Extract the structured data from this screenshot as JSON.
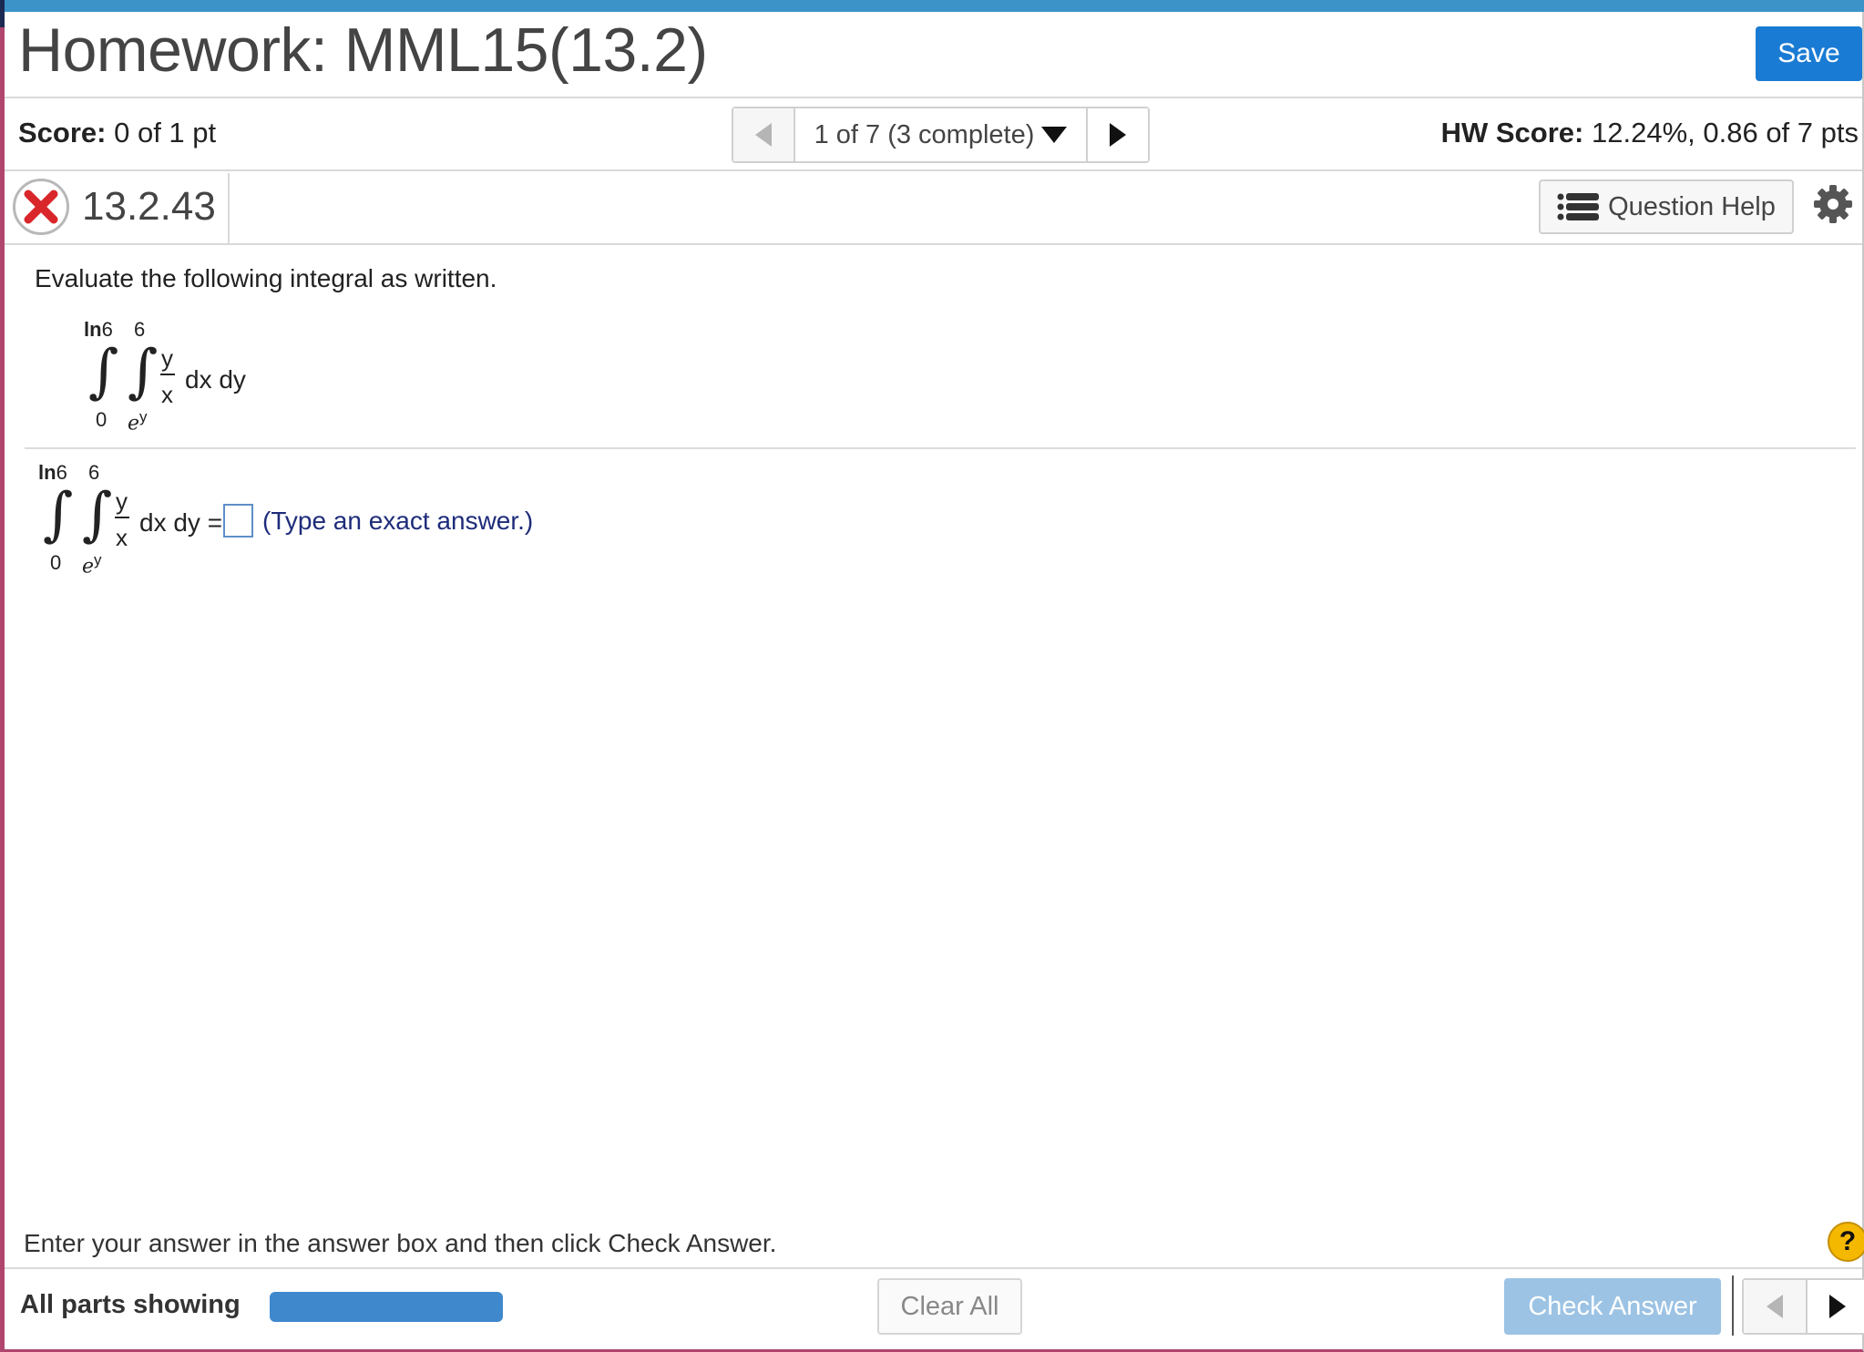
{
  "header": {
    "title": "Homework: MML15(13.2)",
    "save_label": "Save"
  },
  "status": {
    "score_label": "Score:",
    "score_value": "0 of 1 pt",
    "nav_position": "1 of 7 (3 complete)",
    "hw_score_label": "HW Score:",
    "hw_score_value": "12.24%, 0.86 of 7 pts"
  },
  "question": {
    "number": "13.2.43",
    "status": "incorrect",
    "help_label": "Question Help",
    "prompt": "Evaluate the following integral as written.",
    "integral": {
      "outer_upper": "ln",
      "outer_upper_num": "6",
      "outer_lower": "0",
      "inner_upper": "6",
      "inner_lower_base": "e",
      "inner_lower_exp": "y",
      "integrand_num": "y",
      "integrand_den": "x",
      "differentials": "dx dy"
    },
    "answer_equals": "dx dy =",
    "answer_value": "",
    "answer_hint": "(Type an exact answer.)"
  },
  "footer": {
    "instruction": "Enter your answer in the answer box and then click Check Answer.",
    "parts_label": "All parts showing",
    "progress": 1.0,
    "clear_label": "Clear All",
    "check_label": "Check Answer",
    "help_symbol": "?"
  },
  "colors": {
    "accent": "#1a7bd4",
    "topbar": "#3b93c8",
    "incorrect": "#d9262b",
    "hint_text": "#1e2c7a"
  },
  "icons": {
    "status": "x-circle-icon",
    "help": "list-icon",
    "settings": "gear-icon"
  }
}
